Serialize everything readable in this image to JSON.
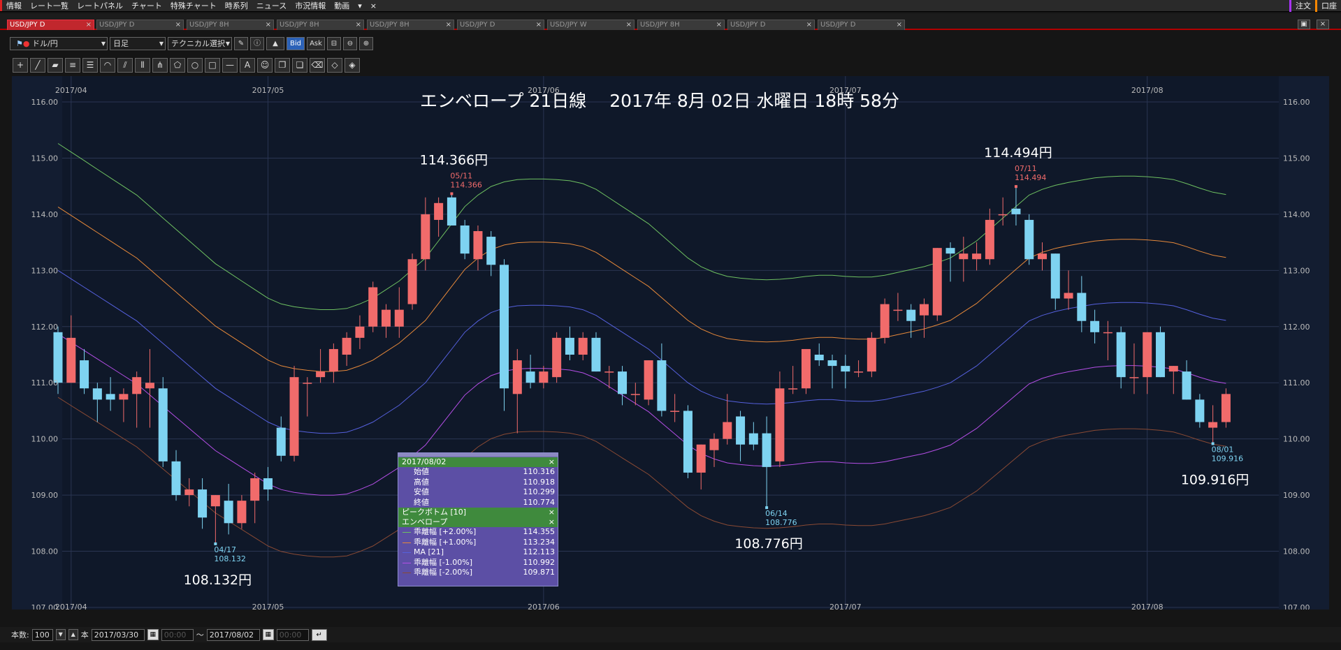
{
  "menubar": {
    "items": [
      "情報",
      "レート一覧",
      "レートパネル",
      "チャート",
      "特殊チャート",
      "時系列",
      "ニュース",
      "市況情報",
      "動画"
    ],
    "order_label": "注文",
    "position_label": "口座"
  },
  "tabs": [
    "USD/JPY D",
    "USD/JPY D",
    "USD/JPY 8H",
    "USD/JPY 8H",
    "USD/JPY 8H",
    "USD/JPY D",
    "USD/JPY W",
    "USD/JPY 8H",
    "USD/JPY D",
    "USD/JPY D"
  ],
  "toolbar": {
    "currency": "ドル/円",
    "period": "日足",
    "technical": "テクニカル選択",
    "bid": "Bid",
    "ask": "Ask"
  },
  "chart": {
    "title": "エンベロープ 21日線　 2017年 8月 02日 水曜日 18時 58分",
    "months": [
      "2017/04",
      "2017/05",
      "2017/06",
      "2017/07",
      "2017/08"
    ],
    "y_ticks": [
      "116.00",
      "115.00",
      "114.00",
      "113.00",
      "112.00",
      "111.00",
      "110.00",
      "109.00",
      "108.00",
      "107.00"
    ],
    "annotations": [
      {
        "label": "114.366円",
        "date": "05/11",
        "value": "114.366",
        "kind": "high"
      },
      {
        "label": "114.494円",
        "date": "07/11",
        "value": "114.494",
        "kind": "high"
      },
      {
        "label": "108.132円",
        "date": "04/17",
        "value": "108.132",
        "kind": "low"
      },
      {
        "label": "108.776円",
        "date": "06/14",
        "value": "108.776",
        "kind": "low"
      },
      {
        "label": "109.916円",
        "date": "08/01",
        "value": "109.916",
        "kind": "low"
      }
    ]
  },
  "chart_data": {
    "type": "candlestick",
    "ylim": [
      107,
      116
    ],
    "candles": [
      [
        111.9,
        112.0,
        110.8,
        111.0
      ],
      [
        111.0,
        112.2,
        111.0,
        111.8
      ],
      [
        111.4,
        111.6,
        110.8,
        110.9
      ],
      [
        110.9,
        111.0,
        110.3,
        110.7
      ],
      [
        110.8,
        111.1,
        110.5,
        110.7
      ],
      [
        110.7,
        110.9,
        110.3,
        110.8
      ],
      [
        110.8,
        111.2,
        110.2,
        111.1
      ],
      [
        110.9,
        111.6,
        110.2,
        111.0
      ],
      [
        110.9,
        111.1,
        109.5,
        109.6
      ],
      [
        109.6,
        109.8,
        108.9,
        109.0
      ],
      [
        109.0,
        109.3,
        108.8,
        109.1
      ],
      [
        109.1,
        109.3,
        108.4,
        108.6
      ],
      [
        108.8,
        109.0,
        108.132,
        109.0
      ],
      [
        108.9,
        109.2,
        108.3,
        108.5
      ],
      [
        108.5,
        109.0,
        108.4,
        108.9
      ],
      [
        108.9,
        109.4,
        108.5,
        109.3
      ],
      [
        109.3,
        109.5,
        108.9,
        109.1
      ],
      [
        110.2,
        110.4,
        109.6,
        109.7
      ],
      [
        109.7,
        111.3,
        109.6,
        111.1
      ],
      [
        111.0,
        111.1,
        110.4,
        111.0
      ],
      [
        111.1,
        111.6,
        111.0,
        111.2
      ],
      [
        111.2,
        111.7,
        111.0,
        111.6
      ],
      [
        111.5,
        111.9,
        111.3,
        111.8
      ],
      [
        111.8,
        112.2,
        111.6,
        112.0
      ],
      [
        112.0,
        112.8,
        111.9,
        112.7
      ],
      [
        112.0,
        112.4,
        111.8,
        112.3
      ],
      [
        112.0,
        112.7,
        111.8,
        112.3
      ],
      [
        112.4,
        113.3,
        112.3,
        113.2
      ],
      [
        113.2,
        114.3,
        113.0,
        114.0
      ],
      [
        113.9,
        114.3,
        113.6,
        114.2
      ],
      [
        114.3,
        114.366,
        113.9,
        113.8
      ],
      [
        113.8,
        113.9,
        113.2,
        113.3
      ],
      [
        113.2,
        113.8,
        113.0,
        113.7
      ],
      [
        113.6,
        113.7,
        112.9,
        113.1
      ],
      [
        113.1,
        113.2,
        110.5,
        110.9
      ],
      [
        110.8,
        111.6,
        110.1,
        111.4
      ],
      [
        111.2,
        111.5,
        110.9,
        111.0
      ],
      [
        111.0,
        111.3,
        110.9,
        111.2
      ],
      [
        111.1,
        111.9,
        111.0,
        111.8
      ],
      [
        111.8,
        112.0,
        111.4,
        111.5
      ],
      [
        111.5,
        111.9,
        111.4,
        111.8
      ],
      [
        111.8,
        111.9,
        111.2,
        111.2
      ],
      [
        111.2,
        111.3,
        110.9,
        111.2
      ],
      [
        111.2,
        111.3,
        110.6,
        110.8
      ],
      [
        110.8,
        111.0,
        110.6,
        110.8
      ],
      [
        110.7,
        111.4,
        110.6,
        111.4
      ],
      [
        111.4,
        111.7,
        110.4,
        110.5
      ],
      [
        110.5,
        110.8,
        110.3,
        110.5
      ],
      [
        110.5,
        110.6,
        109.3,
        109.4
      ],
      [
        109.4,
        109.9,
        109.1,
        109.9
      ],
      [
        109.8,
        110.1,
        109.5,
        110.0
      ],
      [
        110.0,
        110.8,
        109.9,
        110.3
      ],
      [
        110.4,
        110.5,
        109.6,
        109.9
      ],
      [
        110.1,
        110.3,
        109.8,
        109.9
      ],
      [
        110.1,
        110.4,
        108.776,
        109.5
      ],
      [
        109.6,
        111.2,
        109.5,
        110.9
      ],
      [
        110.9,
        111.3,
        110.8,
        110.9
      ],
      [
        110.9,
        111.6,
        110.8,
        111.6
      ],
      [
        111.5,
        111.7,
        111.3,
        111.4
      ],
      [
        111.4,
        111.5,
        110.9,
        111.3
      ],
      [
        111.3,
        111.5,
        110.9,
        111.2
      ],
      [
        111.2,
        111.4,
        111.1,
        111.2
      ],
      [
        111.2,
        111.9,
        111.1,
        111.8
      ],
      [
        111.8,
        112.5,
        111.7,
        112.4
      ],
      [
        112.3,
        112.6,
        112.1,
        112.3
      ],
      [
        112.3,
        112.4,
        111.8,
        112.1
      ],
      [
        112.2,
        112.5,
        111.8,
        112.4
      ],
      [
        112.2,
        113.4,
        112.1,
        113.4
      ],
      [
        113.4,
        113.5,
        112.8,
        113.3
      ],
      [
        113.2,
        113.6,
        112.8,
        113.3
      ],
      [
        113.2,
        113.5,
        113.0,
        113.3
      ],
      [
        113.2,
        114.1,
        113.1,
        113.9
      ],
      [
        114.0,
        114.3,
        113.8,
        114.0
      ],
      [
        114.1,
        114.494,
        113.8,
        114.0
      ],
      [
        113.9,
        114.0,
        113.1,
        113.2
      ],
      [
        113.2,
        113.5,
        113.0,
        113.3
      ],
      [
        113.3,
        113.3,
        112.3,
        112.5
      ],
      [
        112.5,
        113.0,
        112.3,
        112.6
      ],
      [
        112.6,
        112.9,
        111.9,
        112.1
      ],
      [
        112.1,
        112.3,
        111.7,
        111.9
      ],
      [
        111.9,
        112.1,
        111.4,
        111.9
      ],
      [
        111.9,
        112.0,
        110.9,
        111.1
      ],
      [
        111.1,
        111.7,
        110.8,
        111.1
      ],
      [
        111.1,
        111.9,
        110.8,
        111.9
      ],
      [
        111.9,
        112.0,
        111.1,
        111.1
      ],
      [
        111.2,
        111.3,
        110.8,
        111.3
      ],
      [
        111.2,
        111.4,
        110.7,
        110.7
      ],
      [
        110.7,
        110.8,
        110.2,
        110.3
      ],
      [
        110.2,
        110.6,
        109.916,
        110.3
      ],
      [
        110.3,
        110.9,
        110.2,
        110.8
      ]
    ],
    "ma": [
      113.0,
      112.85,
      112.7,
      112.55,
      112.4,
      112.25,
      112.1,
      111.9,
      111.7,
      111.5,
      111.3,
      111.1,
      110.9,
      110.75,
      110.6,
      110.45,
      110.3,
      110.2,
      110.15,
      110.12,
      110.1,
      110.1,
      110.12,
      110.2,
      110.3,
      110.45,
      110.6,
      110.8,
      111.0,
      111.3,
      111.6,
      111.9,
      112.1,
      112.25,
      112.33,
      112.37,
      112.38,
      112.38,
      112.37,
      112.35,
      112.3,
      112.2,
      112.05,
      111.9,
      111.75,
      111.6,
      111.4,
      111.2,
      111.0,
      110.85,
      110.75,
      110.68,
      110.65,
      110.63,
      110.62,
      110.63,
      110.65,
      110.68,
      110.7,
      110.7,
      110.68,
      110.67,
      110.67,
      110.7,
      110.75,
      110.8,
      110.85,
      110.92,
      111.0,
      111.15,
      111.3,
      111.5,
      111.7,
      111.9,
      112.1,
      112.2,
      112.27,
      112.32,
      112.36,
      112.4,
      112.42,
      112.43,
      112.43,
      112.42,
      112.4,
      112.37,
      112.3,
      112.22,
      112.15,
      112.11
    ],
    "envelope_pct": [
      2,
      1,
      -1,
      -2
    ],
    "colors": {
      "up": "#f16b6b",
      "down": "#7ed3f1",
      "ma": "#5560dd",
      "env_p2": "#6ec061",
      "env_p1": "#e5883a",
      "env_m1": "#b44ee6",
      "env_m2": "#8a4a34",
      "grid": "#2a3552",
      "bg": "#0f1829"
    }
  },
  "infobox": {
    "date": "2017/08/02",
    "ohlc": [
      {
        "k": "始値",
        "v": "110.316"
      },
      {
        "k": "高値",
        "v": "110.918"
      },
      {
        "k": "安値",
        "v": "110.299"
      },
      {
        "k": "終値",
        "v": "110.774"
      }
    ],
    "section1": "ピークボトム [10]",
    "section2": "エンベロープ",
    "env": [
      {
        "k": "乖離幅 [+2.00%]",
        "v": "114.355"
      },
      {
        "k": "乖離幅 [+1.00%]",
        "v": "113.234"
      },
      {
        "k": "MA [21]",
        "v": "112.113"
      },
      {
        "k": "乖離幅 [-1.00%]",
        "v": "110.992"
      },
      {
        "k": "乖離幅 [-2.00%]",
        "v": "109.871"
      }
    ]
  },
  "footer": {
    "count_label": "本数:",
    "count": "100",
    "unit": "本",
    "start": "2017/03/30",
    "start_time": "00:00",
    "tilde": "〜",
    "end": "2017/08/02",
    "end_time": "00:00"
  }
}
